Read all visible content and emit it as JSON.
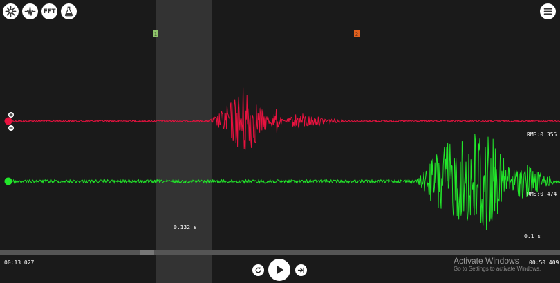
{
  "toolbar": {
    "fft_label": "FFT",
    "icons": [
      "settings-icon",
      "waveform-icon",
      "fft-button",
      "lab-flask-icon",
      "menu-icon"
    ]
  },
  "markers": {
    "marker1": {
      "label": "1",
      "color": "#8fc46a"
    },
    "marker2": {
      "label": "2",
      "color": "#e0601e"
    }
  },
  "selection": {
    "duration_label": "0.132 s"
  },
  "channels": [
    {
      "name": "red",
      "color": "#e8123f",
      "rms_label": "RMS:0.355"
    },
    {
      "name": "green",
      "color": "#22e62a",
      "rms_label": "RMS:0.474"
    }
  ],
  "scale_bar": {
    "label": "0.1 s"
  },
  "timeline": {
    "start_time": "00:13 027",
    "end_time": "00:50 409"
  },
  "playback": {
    "replay_icon": "replay-icon",
    "play_icon": "play-icon",
    "skip_icon": "skip-end-icon"
  },
  "watermark": {
    "title": "Activate Windows",
    "subtitle": "Go to Settings to activate Windows."
  },
  "colors": {
    "background": "#1a1a1a",
    "selection": "#333333",
    "scrollbar": "#555555"
  }
}
